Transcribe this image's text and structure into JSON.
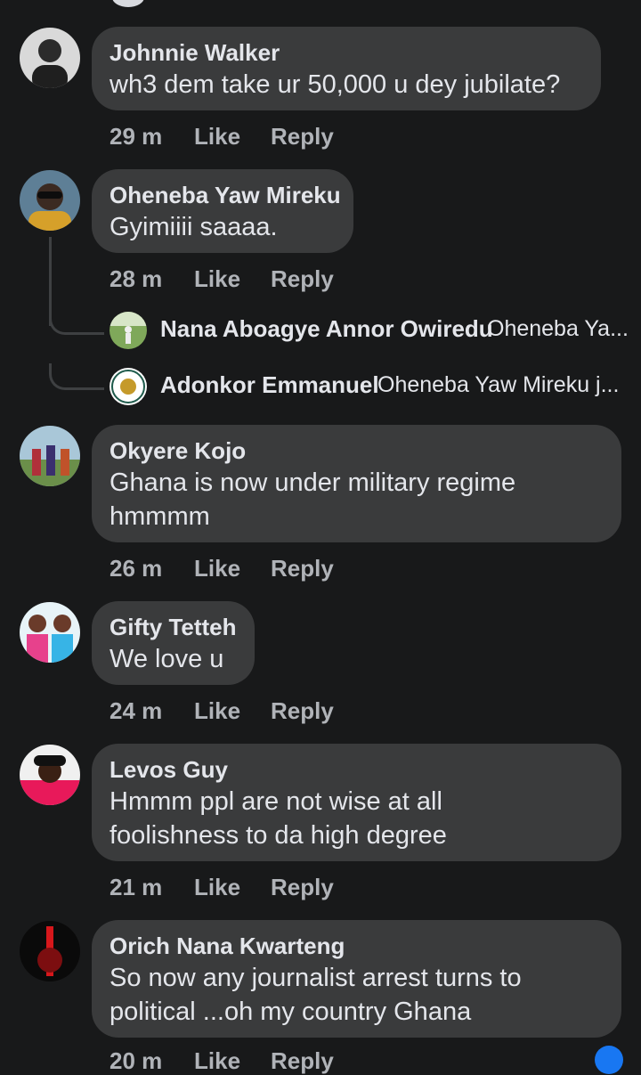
{
  "actions": {
    "like": "Like",
    "reply": "Reply"
  },
  "comments": [
    {
      "name": "Johnnie Walker",
      "text": [
        "wh3 dem take ur 50,000 u dey jubilate?"
      ],
      "time": "29 m"
    },
    {
      "name": "Oheneba Yaw Mireku",
      "text": [
        "Gyimiiii saaaa."
      ],
      "time": "28 m"
    },
    {
      "name": "Okyere Kojo",
      "text": [
        "Ghana is now under military regime",
        "hmmmm"
      ],
      "time": "26 m"
    },
    {
      "name": "Gifty Tetteh",
      "text": [
        "We love u"
      ],
      "time": "24 m"
    },
    {
      "name": "Levos Guy",
      "text": [
        "Hmmm ppl are not wise at all",
        "foolishness to da high degree"
      ],
      "time": "21 m"
    },
    {
      "name": "Orich Nana Kwarteng",
      "text": [
        "So now any journalist arrest turns to",
        "political ...oh my country Ghana"
      ],
      "time": "20 m"
    }
  ],
  "replies": [
    {
      "name": "Nana Aboagye Annor Owiredu",
      "preview": "Oheneba Ya..."
    },
    {
      "name": "Adonkor Emmanuel",
      "preview": "Oheneba Yaw Mireku j..."
    }
  ],
  "colors": {
    "background": "#18191a",
    "bubble": "#3a3b3c",
    "text": "#e4e6eb",
    "secondary": "#b0b3b8",
    "accent": "#1877f2"
  }
}
